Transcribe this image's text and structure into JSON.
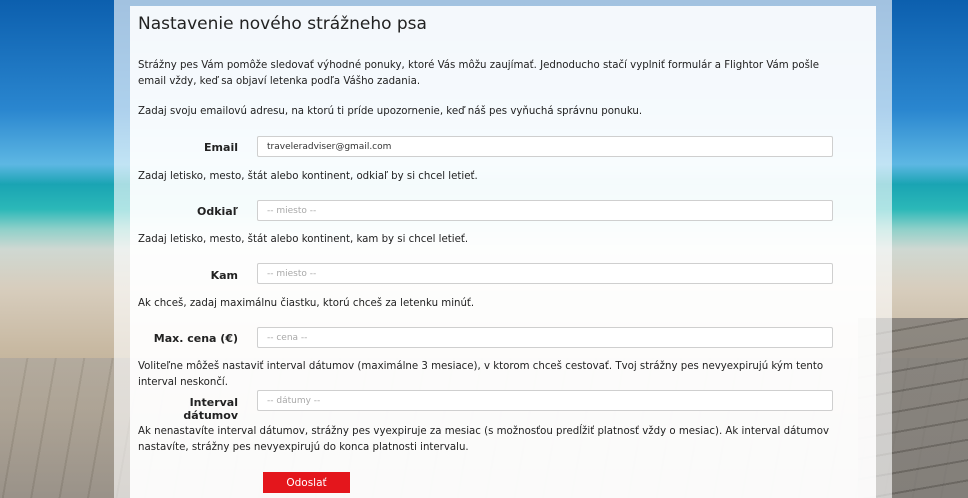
{
  "form": {
    "title": "Nastavenie nového strážneho psa",
    "intro": "Strážny pes Vám pomôže sledovať výhodné ponuky, ktoré Vás môžu zaujímať. Jednoducho stačí vyplniť formulár a Flightor Vám pošle email vždy, keď sa objaví letenka podľa Vášho zadania.",
    "email_hint": "Zadaj svoju emailovú adresu, na ktorú ti príde upozornenie, keď náš pes vyňuchá správnu ponuku.",
    "email_label": "Email",
    "email_value": "traveleradviser@gmail.com",
    "from_hint": "Zadaj letisko, mesto, štát alebo kontinent, odkiaľ by si chcel letieť.",
    "from_label": "Odkiaľ",
    "from_placeholder": "-- miesto --",
    "to_hint": "Zadaj letisko, mesto, štát alebo kontinent, kam by si chcel letieť.",
    "to_label": "Kam",
    "to_placeholder": "-- miesto --",
    "price_hint": "Ak chceš, zadaj maximálnu čiastku, ktorú chceš za letenku minúť.",
    "price_label": "Max. cena (€)",
    "price_placeholder": "-- cena --",
    "interval_hint": "Voliteľne môžeš nastaviť interval dátumov (maximálne 3 mesiace), v ktorom chceš cestovať. Tvoj strážny pes nevyexpirujú kým tento interval neskončí.",
    "interval_label": "Interval dátumov",
    "interval_placeholder": "-- dátumy --",
    "footer_note": "Ak nenastavíte interval dátumov, strážny pes vyexpiruje za mesiac (s možnosťou predĺžiť platnosť vždy o mesiac). Ak interval dátumov nastavíte, strážny pes nevyexpirujú do konca platnosti intervalu.",
    "submit_label": "Odoslať"
  }
}
